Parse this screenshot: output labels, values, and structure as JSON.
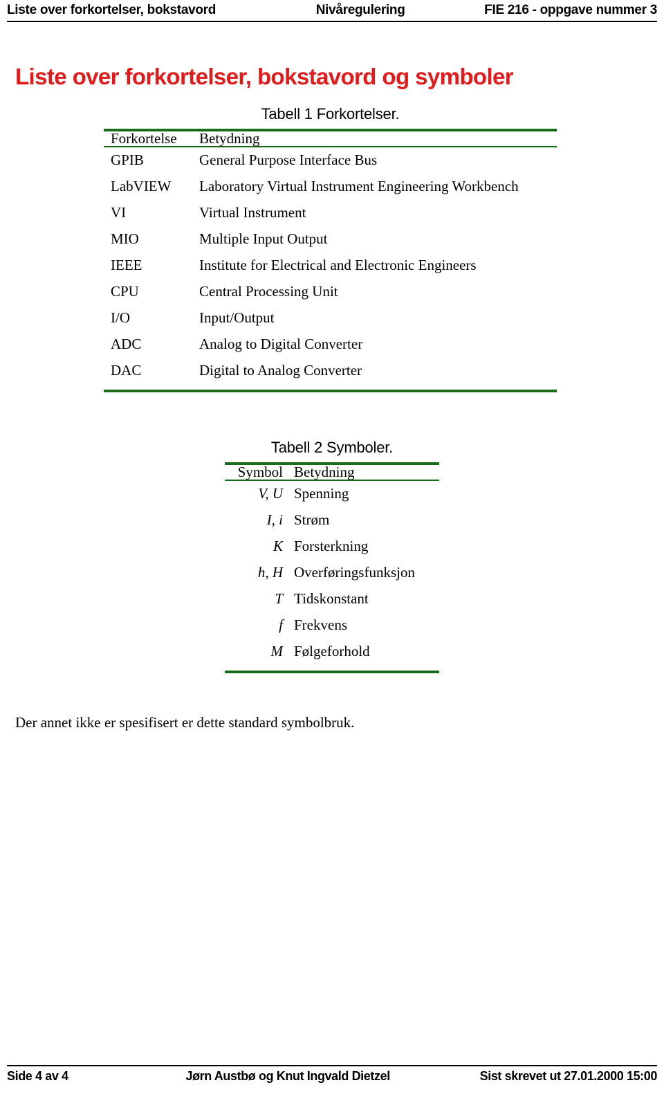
{
  "header": {
    "left": "Liste over forkortelser, bokstavord",
    "center": "Nivåregulering",
    "right": "FIE 216 - oppgave nummer 3"
  },
  "title": {
    "text": "Liste over forkortelser, bokstavord og symboler",
    "color": "#e01b1b"
  },
  "table1": {
    "caption": "Tabell 1 Forkortelser.",
    "rule_color": "#1a6b1a",
    "columns": [
      "Forkortelse",
      "Betydning"
    ],
    "rows": [
      {
        "key": "GPIB",
        "value": "General Purpose Interface Bus"
      },
      {
        "key": "LabVIEW",
        "value": "Laboratory Virtual Instrument Engineering Workbench"
      },
      {
        "key": "VI",
        "value": "Virtual Instrument"
      },
      {
        "key": "MIO",
        "value": "Multiple Input Output"
      },
      {
        "key": "IEEE",
        "value": "Institute for Electrical and Electronic Engineers"
      },
      {
        "key": "CPU",
        "value": "Central Processing Unit"
      },
      {
        "key": "I/O",
        "value": "Input/Output"
      },
      {
        "key": "ADC",
        "value": "Analog to Digital Converter"
      },
      {
        "key": "DAC",
        "value": "Digital to Analog Converter"
      }
    ]
  },
  "table2": {
    "caption": "Tabell 2 Symboler.",
    "rule_color": "#1a6b1a",
    "columns": [
      "Symbol",
      "Betydning"
    ],
    "rows": [
      {
        "key": "V, U",
        "value": "Spenning"
      },
      {
        "key": "I, i",
        "value": "Strøm"
      },
      {
        "key": "K",
        "value": "Forsterkning"
      },
      {
        "key": "h, H",
        "value": "Overføringsfunksjon"
      },
      {
        "key": "T",
        "value": "Tidskonstant"
      },
      {
        "key": "f",
        "value": "Frekvens"
      },
      {
        "key": "M",
        "value": "Følgeforhold"
      }
    ]
  },
  "closing_note": "Der annet ikke er spesifisert er dette standard symbolbruk.",
  "footer": {
    "left": "Side 4 av 4",
    "center": "Jørn Austbø og Knut Ingvald Dietzel",
    "right": "Sist skrevet ut 27.01.2000 15:00"
  }
}
